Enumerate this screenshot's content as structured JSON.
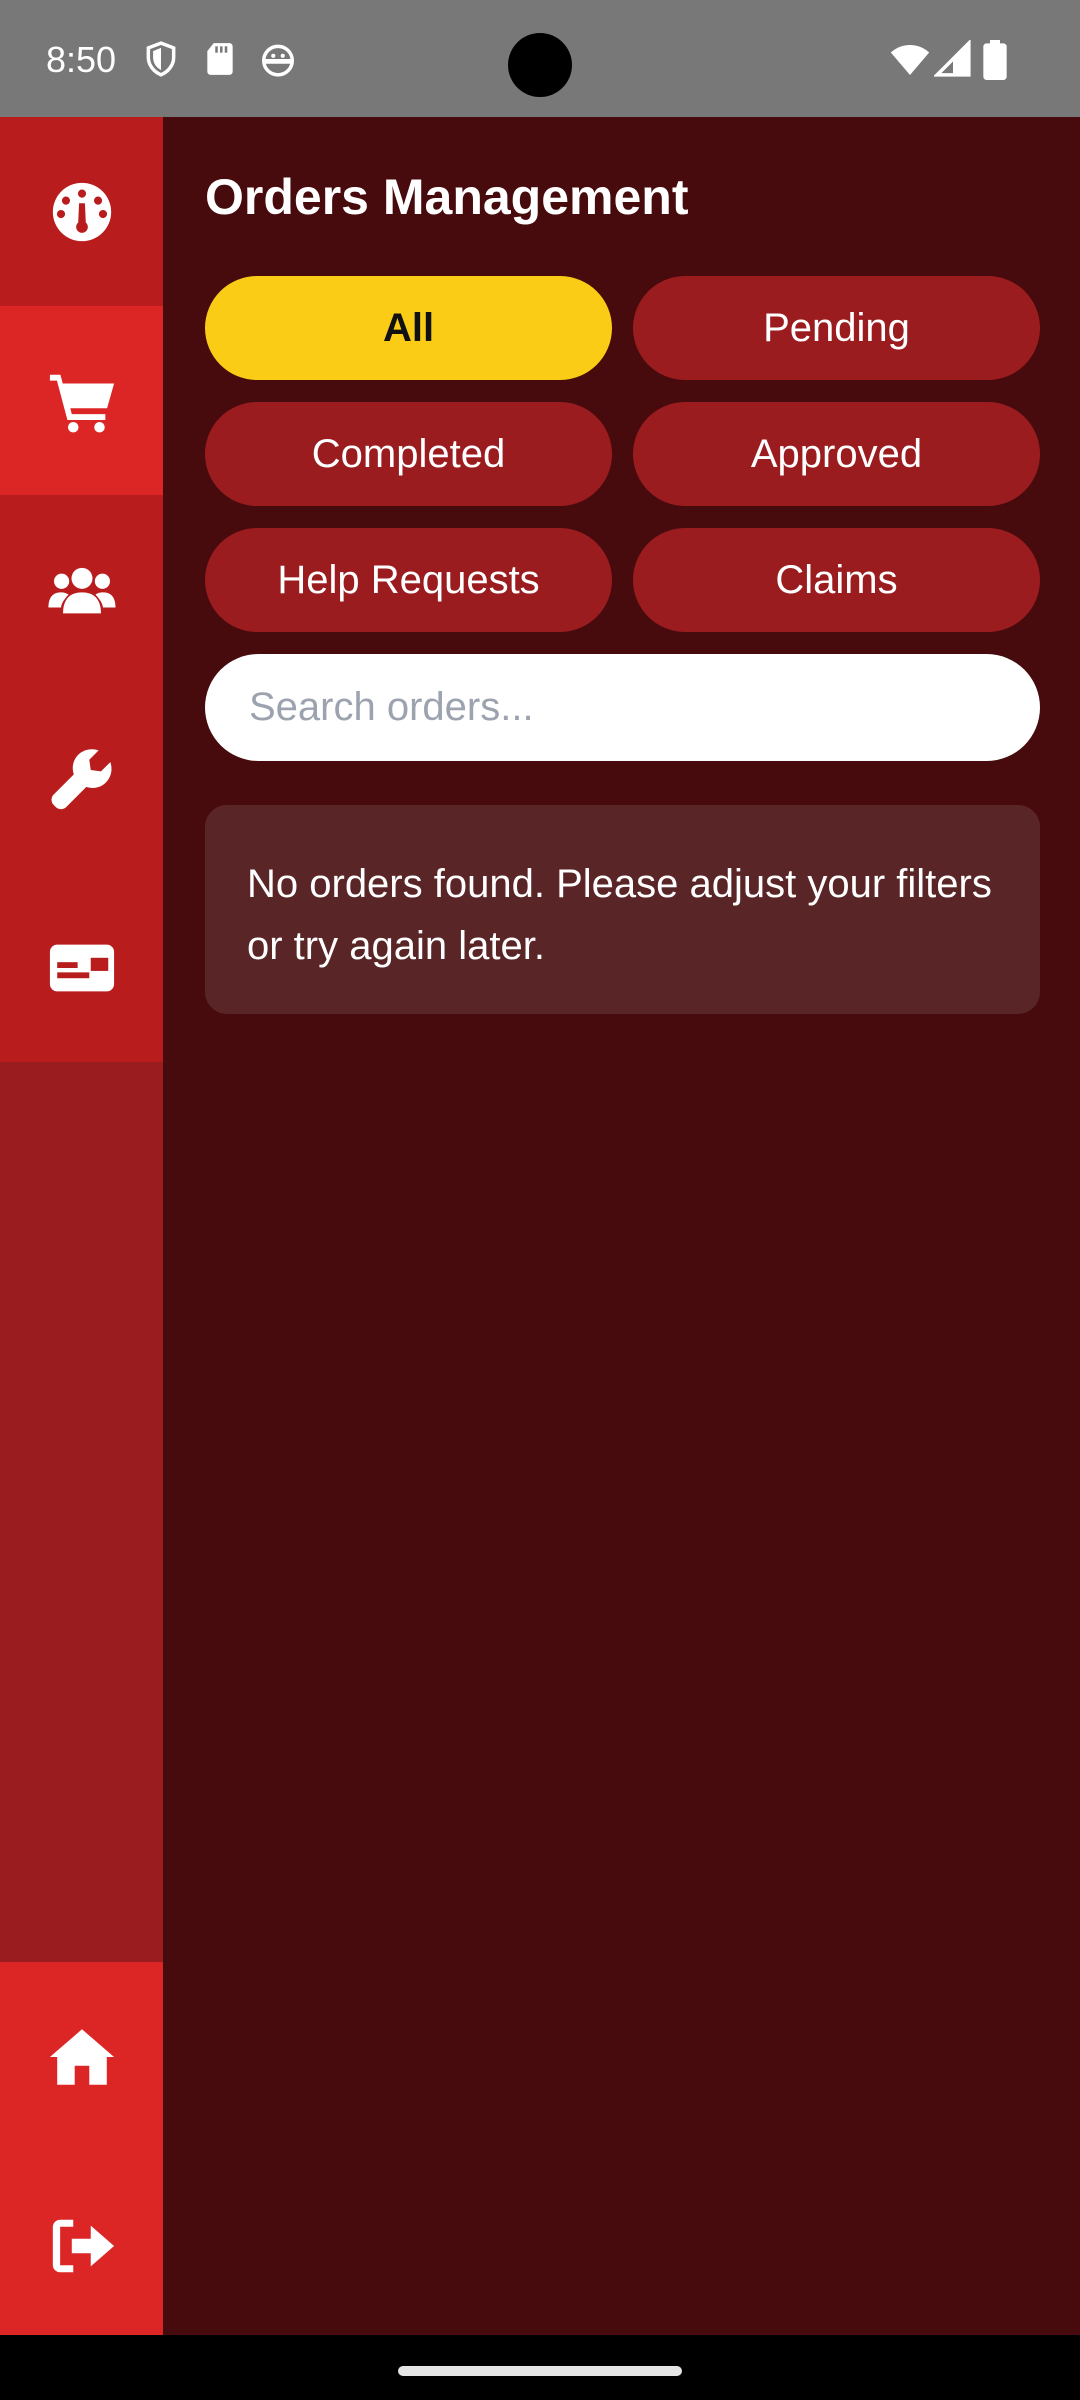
{
  "status_bar": {
    "time": "8:50",
    "icons": [
      "shield-icon",
      "sd-card-icon",
      "android-face-icon",
      "wifi-icon",
      "signal-icon",
      "battery-icon"
    ]
  },
  "sidebar": {
    "items": [
      {
        "name": "dashboard",
        "icon": "speedometer-icon",
        "active": false
      },
      {
        "name": "orders",
        "icon": "cart-icon",
        "active": true
      },
      {
        "name": "users",
        "icon": "users-icon",
        "active": false
      },
      {
        "name": "services",
        "icon": "wrench-icon",
        "active": false
      },
      {
        "name": "cards",
        "icon": "id-card-icon",
        "active": false
      }
    ],
    "bottom_items": [
      {
        "name": "home",
        "icon": "home-icon"
      },
      {
        "name": "logout",
        "icon": "logout-icon"
      }
    ]
  },
  "main": {
    "title": "Orders Management",
    "filters": [
      {
        "label": "All",
        "selected": true
      },
      {
        "label": "Pending",
        "selected": false
      },
      {
        "label": "Completed",
        "selected": false
      },
      {
        "label": "Approved",
        "selected": false
      },
      {
        "label": "Help Requests",
        "selected": false
      },
      {
        "label": "Claims",
        "selected": false
      }
    ],
    "search": {
      "placeholder": "Search orders...",
      "value": ""
    },
    "empty_message": "No orders found. Please adjust your filters or try again later."
  },
  "colors": {
    "background": "#470b0d",
    "sidebar": "#9b1c1f",
    "sidebar_active": "#dc2626",
    "chip": "#9b1c1f",
    "chip_selected": "#facc15",
    "status_bar": "#787878"
  }
}
